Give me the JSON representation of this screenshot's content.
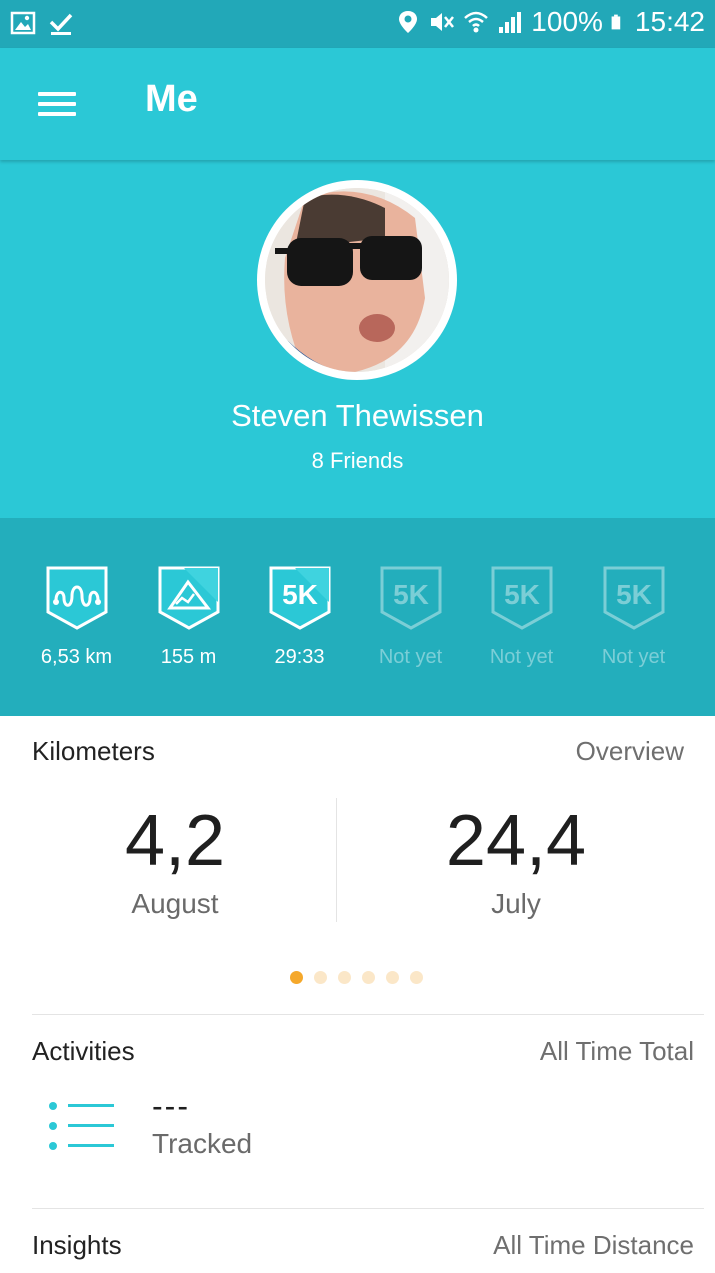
{
  "status_bar": {
    "battery": "100%",
    "time": "15:42",
    "icons": [
      "image-icon",
      "check-icon",
      "location-icon",
      "mute-icon",
      "wifi-icon",
      "signal-icon",
      "battery-icon"
    ]
  },
  "app_bar": {
    "title": "Me",
    "menu_icon": "hamburger-menu-icon"
  },
  "profile": {
    "name": "Steven Thewissen",
    "friends": "8 Friends"
  },
  "badges": [
    {
      "icon": "distance-badge-icon",
      "label": "6,53 km",
      "achieved": true
    },
    {
      "icon": "elevation-badge-icon",
      "label": "155 m",
      "achieved": true
    },
    {
      "icon": "5k-badge-icon",
      "label": "29:33",
      "achieved": true
    },
    {
      "icon": "5k-badge-icon",
      "label": "Not yet",
      "achieved": false
    },
    {
      "icon": "5k-badge-icon",
      "label": "Not yet",
      "achieved": false
    },
    {
      "icon": "5k-badge-icon",
      "label": "Not yet",
      "achieved": false
    }
  ],
  "badge_text": "5K",
  "kilometers": {
    "title": "Kilometers",
    "link": "Overview",
    "stats": [
      {
        "value": "4,2",
        "label": "August"
      },
      {
        "value": "24,4",
        "label": "July"
      }
    ],
    "pager": {
      "count": 6,
      "active": 1
    }
  },
  "activities": {
    "title": "Activities",
    "link": "All Time Total",
    "value": "---",
    "label": "Tracked",
    "icon": "list-icon"
  },
  "insights": {
    "title": "Insights",
    "link": "All Time Distance"
  },
  "colors": {
    "accent": "#2bc8d6",
    "badge_band": "#23aebc",
    "status_bar": "#22a8b8",
    "pager_active": "#f5a82b",
    "pager_inactive": "#fbe7c8"
  }
}
